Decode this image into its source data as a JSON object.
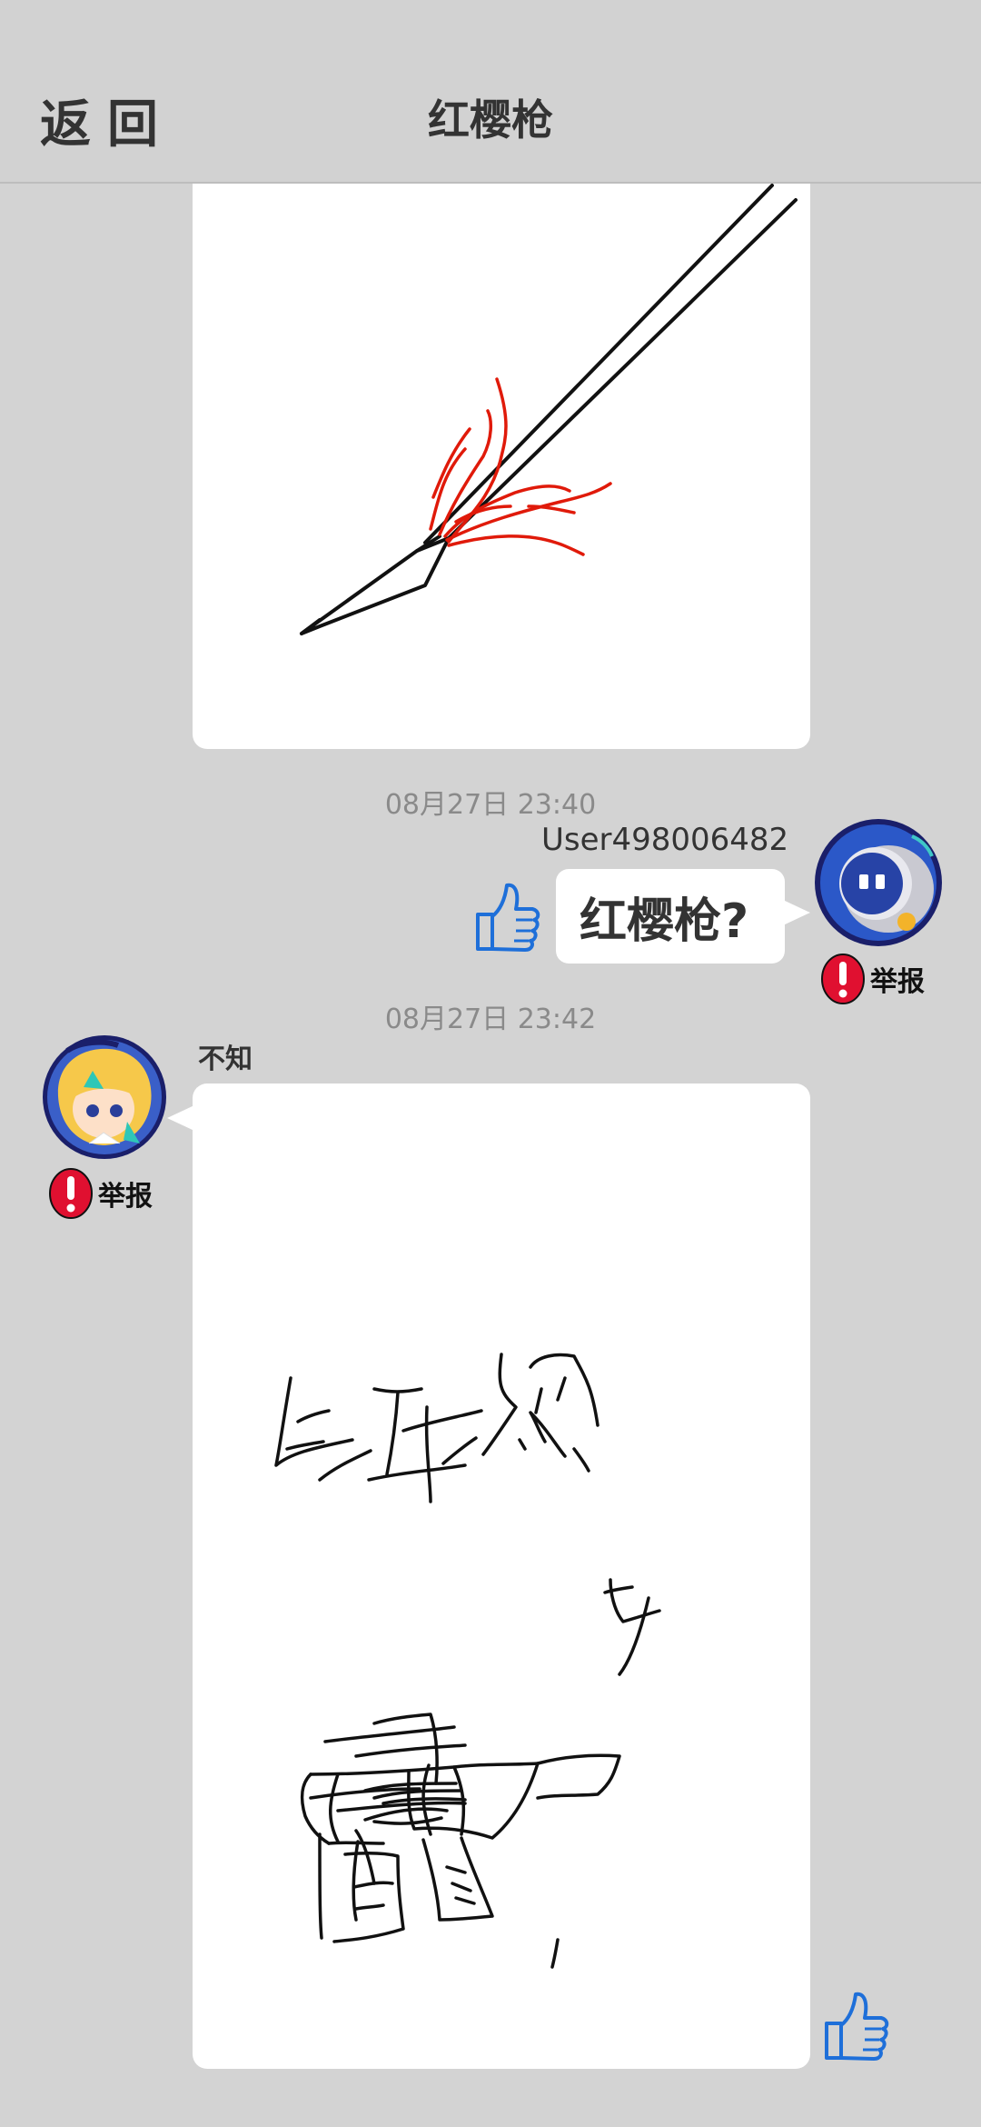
{
  "header": {
    "back_label": "返回",
    "title": "红樱枪"
  },
  "messages": [
    {
      "type": "drawing",
      "side": "other",
      "image_description": "red-tasseled spear sketch"
    },
    {
      "timestamp": "08月27日  23:40",
      "side": "self",
      "username": "User498006482",
      "text": "红樱枪?",
      "report_label": "举报"
    },
    {
      "timestamp": "08月27日  23:42",
      "side": "other",
      "username": "不知",
      "type": "drawing",
      "report_label": "举报"
    }
  ],
  "colors": {
    "background": "#d3d3d3",
    "card": "#ffffff",
    "accent_blue": "#1e6fd9",
    "report_red": "#e01030",
    "tassel_red": "#e01a0a"
  }
}
